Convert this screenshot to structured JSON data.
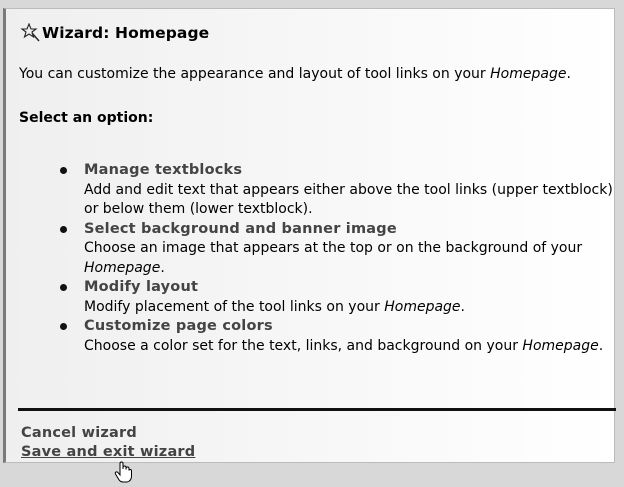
{
  "wizard": {
    "title": "Wizard: Homepage",
    "title_icon": "wand-icon"
  },
  "intro": {
    "text_before": "You can customize the appearance and layout of tool links on your ",
    "text_italic": "Homepage",
    "text_after": "."
  },
  "select_label": "Select an option:",
  "options": [
    {
      "label": "Manage textblocks",
      "desc_before": "Add and edit text that appears either above the tool links (upper textblock) or below them (lower textblock).",
      "desc_italic": "",
      "desc_after": ""
    },
    {
      "label": "Select background and banner image",
      "desc_before": "Choose an image that appears at the top or on the background of your ",
      "desc_italic": "Homepage",
      "desc_after": "."
    },
    {
      "label": "Modify layout",
      "desc_before": "Modify placement of the tool links on your ",
      "desc_italic": "Homepage",
      "desc_after": "."
    },
    {
      "label": "Customize page colors",
      "desc_before": "Choose a color set for the text, links, and background on your ",
      "desc_italic": "Homepage",
      "desc_after": "."
    }
  ],
  "footer": {
    "cancel_label": "Cancel wizard",
    "save_label": "Save and exit wizard"
  },
  "colors": {
    "link": "#444444",
    "divider": "#111111",
    "panel_border": "#7a7a7a"
  }
}
